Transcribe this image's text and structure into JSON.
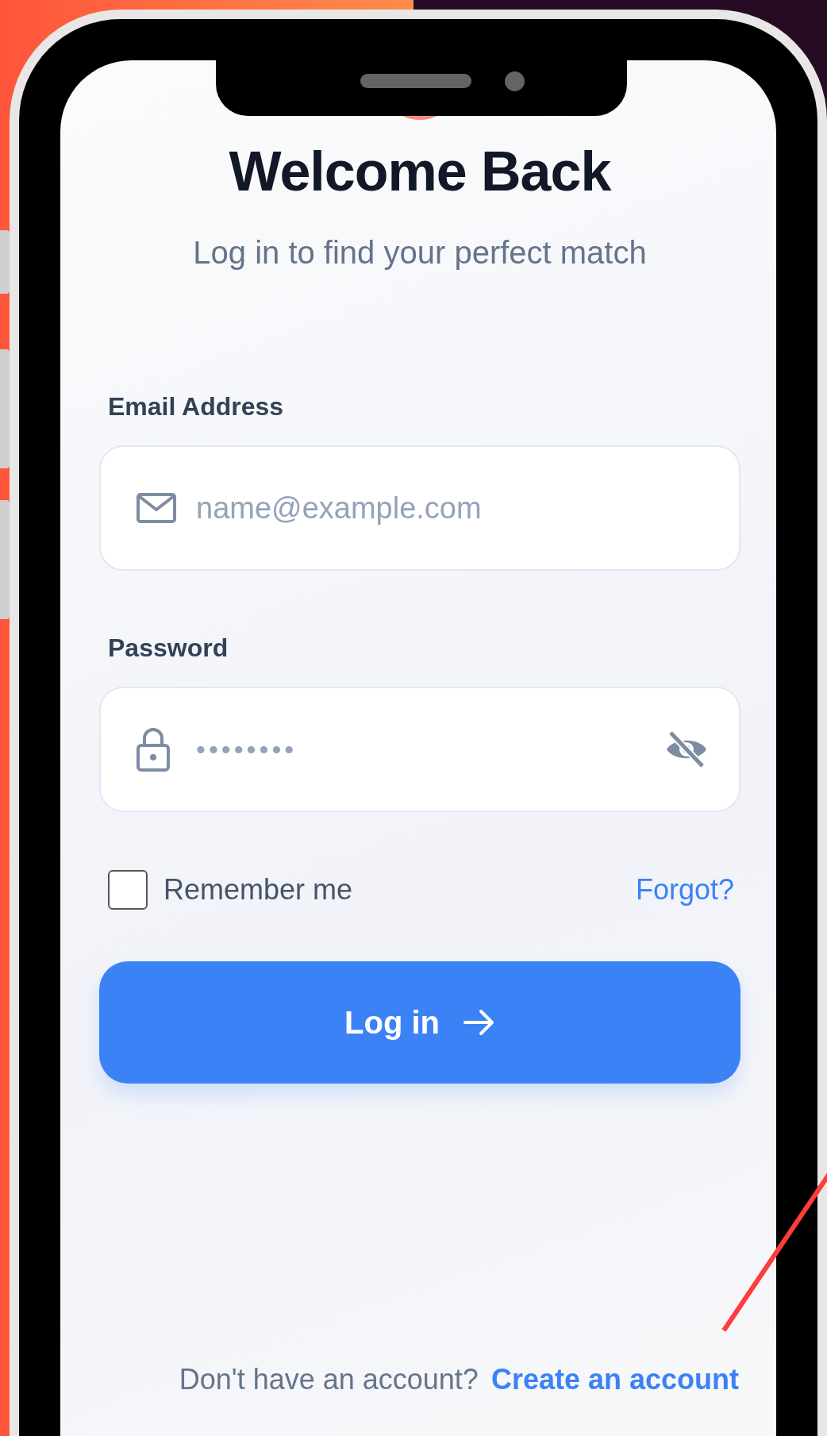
{
  "title": "Welcome Back",
  "subtitle": "Log in to find your perfect match",
  "fields": [
    {
      "kind": "email",
      "label": "Email Address",
      "placeholder": "name@example.com"
    },
    {
      "kind": "password",
      "label": "Password",
      "value": "••••••••"
    }
  ],
  "remember": {
    "label": "Remember me",
    "checked": false
  },
  "forgot": "Forgot?",
  "login_button": "Log in",
  "footer": {
    "text": "Don't have an account?",
    "link": "Create an account"
  }
}
